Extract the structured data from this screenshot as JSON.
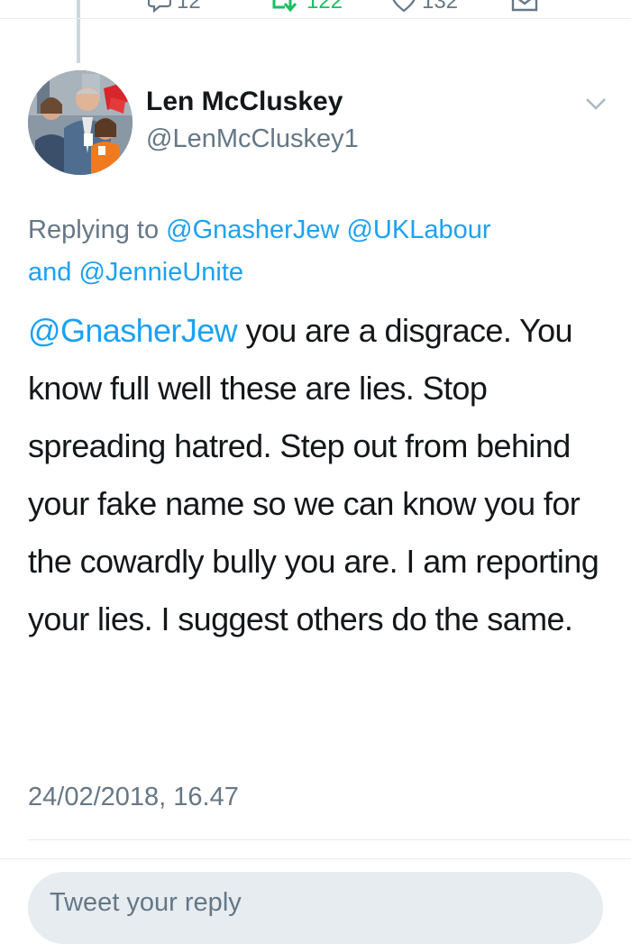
{
  "previous_tweet": {
    "actions": [
      {
        "name": "reply",
        "icon": "reply-icon",
        "count": "12"
      },
      {
        "name": "retweet",
        "icon": "retweet-icon",
        "count": "122",
        "active": true,
        "color": "#17bf63"
      },
      {
        "name": "like",
        "icon": "heart-icon",
        "count": "132"
      },
      {
        "name": "share",
        "icon": "share-icon",
        "count": ""
      }
    ]
  },
  "tweet": {
    "author": {
      "name": "Len McCluskey",
      "handle": "@LenMcCluskey1",
      "avatar": "profile-photo"
    },
    "replying_to": {
      "prefix": "Replying to ",
      "mention_1": "@GnasherJew",
      "mention_2": "@UKLabour",
      "connector": "and",
      "mention_3": "@JennieUnite"
    },
    "text": {
      "mention": "@GnasherJew",
      "body": " you are a disgrace.  You know full well these are lies. Stop spreading hatred. Step out from behind your fake name so we can know you for the cowardly bully you are. I am reporting your lies. I suggest others do the same."
    },
    "timestamp": "24/02/2018, 16.47"
  },
  "reply_box": {
    "placeholder": "Tweet your reply"
  },
  "colors": {
    "link": "#1da1f2",
    "secondary_text": "#657786",
    "primary_text": "#14171a",
    "retweet_active": "#17bf63",
    "divider": "#e6ecf0"
  }
}
